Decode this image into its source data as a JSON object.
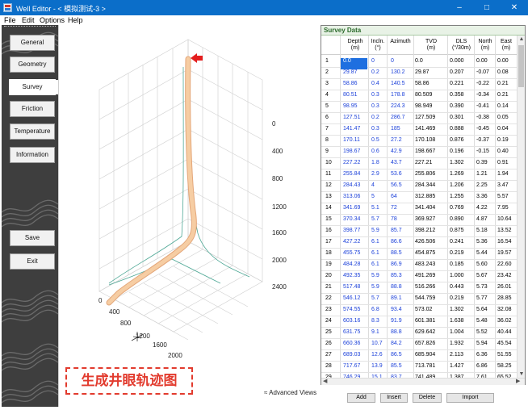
{
  "window": {
    "title": "Well Editor - < 模拟测试-3 >",
    "minimize_glyph": "–",
    "maximize_glyph": "□",
    "close_glyph": "✕"
  },
  "menu": [
    "File",
    "Edit",
    "Options",
    "Help"
  ],
  "sidebar": {
    "buttons": [
      {
        "label": "General",
        "active": false
      },
      {
        "label": "Geometry",
        "active": false
      },
      {
        "label": "Survey",
        "active": true
      },
      {
        "label": "Friction",
        "active": false
      },
      {
        "label": "Temperature",
        "active": false
      },
      {
        "label": "Information",
        "active": false
      },
      {
        "label": "Save",
        "active": false
      },
      {
        "label": "Exit",
        "active": false
      }
    ]
  },
  "view3d": {
    "axis_depth_ticks": [
      "0",
      "400",
      "800",
      "1200",
      "1600",
      "2000",
      "2400"
    ],
    "axis_bottom_left_ticks": [
      "0",
      "400",
      "800",
      "1200"
    ],
    "axis_bottom_right_ticks": [
      "1600",
      "2000"
    ],
    "advanced_views_label": "≈ Advanced Views",
    "caption": "生成井眼轨迹图",
    "colors": {
      "trajectory": "#f4c89c",
      "projection": "#4fa896",
      "marker": "#e41e1e",
      "grid": "#c9c9c9"
    }
  },
  "survey": {
    "title": "Survey Data",
    "columns": [
      {
        "name": "Depth",
        "unit": "(m)"
      },
      {
        "name": "Incln.",
        "unit": "(°)"
      },
      {
        "name": "Azimuth",
        "unit": ""
      },
      {
        "name": "TVD",
        "unit": "(m)"
      },
      {
        "name": "DLS",
        "unit": "(°/30m)"
      },
      {
        "name": "North",
        "unit": "(m)"
      },
      {
        "name": "East",
        "unit": "(m)"
      }
    ],
    "rows": [
      [
        "1",
        "0.0",
        "0",
        "0",
        "0.0",
        "0.000",
        "0.00",
        "0.00"
      ],
      [
        "2",
        "29.87",
        "0.2",
        "130.2",
        "29.87",
        "0.207",
        "-0.07",
        "0.08"
      ],
      [
        "3",
        "58.86",
        "0.4",
        "140.5",
        "58.86",
        "0.221",
        "-0.22",
        "0.21"
      ],
      [
        "4",
        "80.51",
        "0.3",
        "178.8",
        "80.509",
        "0.358",
        "-0.34",
        "0.21"
      ],
      [
        "5",
        "98.95",
        "0.3",
        "224.3",
        "98.949",
        "0.390",
        "-0.41",
        "0.14"
      ],
      [
        "6",
        "127.51",
        "0.2",
        "286.7",
        "127.509",
        "0.301",
        "-0.38",
        "0.05"
      ],
      [
        "7",
        "141.47",
        "0.3",
        "185",
        "141.469",
        "0.888",
        "-0.45",
        "0.04"
      ],
      [
        "8",
        "170.11",
        "0.5",
        "27.2",
        "170.108",
        "0.876",
        "-0.37",
        "0.19"
      ],
      [
        "9",
        "198.67",
        "0.6",
        "42.9",
        "198.667",
        "0.196",
        "-0.15",
        "0.40"
      ],
      [
        "10",
        "227.22",
        "1.8",
        "43.7",
        "227.21",
        "1.302",
        "0.39",
        "0.91"
      ],
      [
        "11",
        "255.84",
        "2.9",
        "53.6",
        "255.806",
        "1.269",
        "1.21",
        "1.94"
      ],
      [
        "12",
        "284.43",
        "4",
        "56.5",
        "284.344",
        "1.206",
        "2.25",
        "3.47"
      ],
      [
        "13",
        "313.06",
        "5",
        "64",
        "312.885",
        "1.255",
        "3.36",
        "5.57"
      ],
      [
        "14",
        "341.69",
        "5.1",
        "72",
        "341.404",
        "0.769",
        "4.22",
        "7.95"
      ],
      [
        "15",
        "370.34",
        "5.7",
        "78",
        "369.927",
        "0.890",
        "4.87",
        "10.64"
      ],
      [
        "16",
        "398.77",
        "5.9",
        "85.7",
        "398.212",
        "0.875",
        "5.18",
        "13.52"
      ],
      [
        "17",
        "427.22",
        "6.1",
        "86.6",
        "426.506",
        "0.241",
        "5.36",
        "16.54"
      ],
      [
        "18",
        "455.75",
        "6.1",
        "88.5",
        "454.875",
        "0.219",
        "5.44",
        "19.57"
      ],
      [
        "19",
        "484.28",
        "6.1",
        "86.9",
        "483.243",
        "0.185",
        "5.60",
        "22.60"
      ],
      [
        "20",
        "492.35",
        "5.9",
        "85.3",
        "491.269",
        "1.000",
        "5.67",
        "23.42"
      ],
      [
        "21",
        "517.48",
        "5.9",
        "88.8",
        "516.266",
        "0.443",
        "5.73",
        "26.01"
      ],
      [
        "22",
        "546.12",
        "5.7",
        "89.1",
        "544.759",
        "0.219",
        "5.77",
        "28.85"
      ],
      [
        "23",
        "574.55",
        "6.8",
        "93.4",
        "573.02",
        "1.302",
        "5.64",
        "32.08"
      ],
      [
        "24",
        "603.16",
        "8.3",
        "91.9",
        "601.381",
        "1.638",
        "5.48",
        "36.02"
      ],
      [
        "25",
        "631.75",
        "9.1",
        "88.8",
        "629.642",
        "1.004",
        "5.52",
        "40.44"
      ],
      [
        "26",
        "660.36",
        "10.7",
        "84.2",
        "657.826",
        "1.932",
        "5.94",
        "45.54"
      ],
      [
        "27",
        "689.03",
        "12.6",
        "86.5",
        "685.904",
        "2.113",
        "6.36",
        "51.55"
      ],
      [
        "28",
        "717.67",
        "13.9",
        "85.5",
        "713.781",
        "1.427",
        "6.86",
        "58.25"
      ],
      [
        "29",
        "746.29",
        "15.1",
        "83.7",
        "741.489",
        "1.387",
        "7.61",
        "65.52"
      ]
    ]
  },
  "buttons": {
    "add": "Add",
    "insert": "Insert",
    "delete": "Delete",
    "import": "Import"
  }
}
